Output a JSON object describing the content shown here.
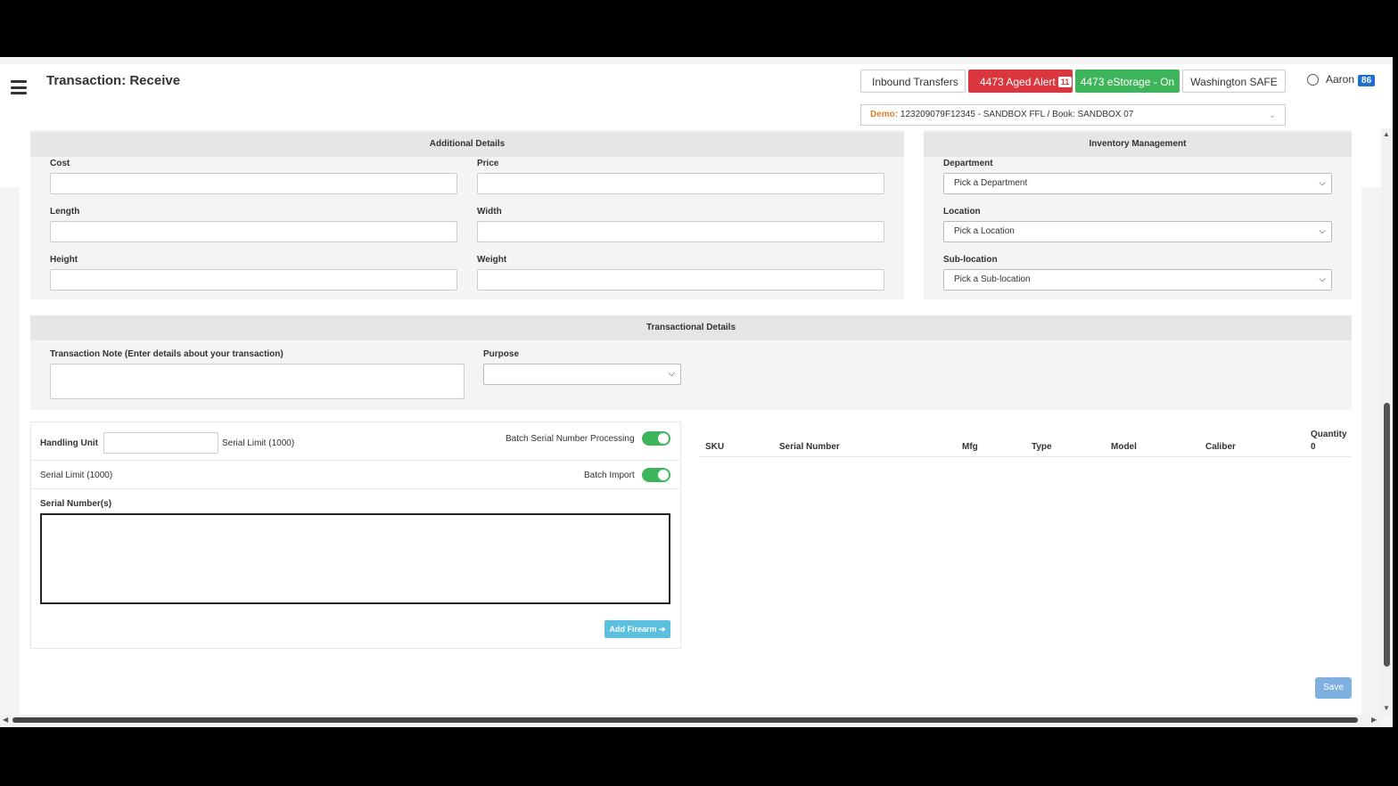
{
  "header": {
    "title": "Transaction: Receive",
    "buttons": {
      "inbound": "Inbound Transfers",
      "aged_alert": "4473 Aged Alert",
      "aged_alert_badge": "11",
      "estorage": "4473 eStorage - On",
      "washington": "Washington SAFE"
    },
    "user": {
      "name": "Aaron",
      "badge": "86"
    },
    "ffl_select": {
      "prefix": "Demo:",
      "value": "123209079F12345 - SANDBOX FFL / Book: SANDBOX 07"
    }
  },
  "additional_details": {
    "heading": "Additional Details",
    "fields": {
      "cost": {
        "label": "Cost",
        "value": ""
      },
      "price": {
        "label": "Price",
        "value": ""
      },
      "length": {
        "label": "Length",
        "value": ""
      },
      "width": {
        "label": "Width",
        "value": ""
      },
      "height": {
        "label": "Height",
        "value": ""
      },
      "weight": {
        "label": "Weight",
        "value": ""
      }
    }
  },
  "inventory_management": {
    "heading": "Inventory Management",
    "department": {
      "label": "Department",
      "selected": "Pick a Department"
    },
    "location": {
      "label": "Location",
      "selected": "Pick a Location"
    },
    "sublocation": {
      "label": "Sub-location",
      "selected": "Pick a Sub-location"
    }
  },
  "transactional_details": {
    "heading": "Transactional Details",
    "note_label": "Transaction Note",
    "note_hint": "(Enter details about your transaction)",
    "note_value": "",
    "purpose_label": "Purpose",
    "purpose_selected": ""
  },
  "serial_panel": {
    "handling_unit_label": "Handling Unit",
    "handling_unit_value": "",
    "serial_limit_1": "Serial Limit (1000)",
    "batch_serial_label": "Batch Serial Number Processing",
    "serial_limit_2": "Serial Limit (1000)",
    "batch_import_label": "Batch Import",
    "serial_numbers_label": "Serial Number(s)",
    "serial_numbers_value": "",
    "add_firearm": "Add Firearm ➔"
  },
  "table": {
    "columns": [
      "SKU",
      "Serial Number",
      "Mfg",
      "Type",
      "Model",
      "Caliber",
      "Quantity"
    ],
    "quantity_total": "0"
  },
  "save_label": "Save",
  "colors": {
    "red": "#d9363e",
    "green": "#3fb55b",
    "blue_badge": "#1f6fd1",
    "info": "#5bc0de"
  }
}
